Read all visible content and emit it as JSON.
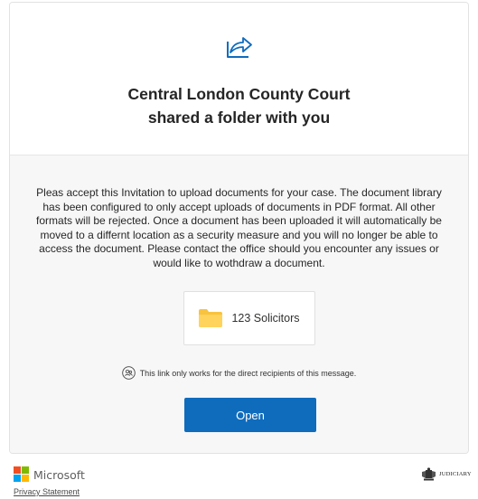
{
  "header": {
    "icon": "share-arrow-icon",
    "title_line1": "Central London County Court",
    "title_line2": "shared a folder with you"
  },
  "message": {
    "text": "Pleas accept this Invitation to upload documents for your case.  The document library has been configured to only accept uploads of documents in PDF format.  All other formats will be rejected.  Once a document has been uploaded it will automatically be moved to a differnt location as a security measure and you will no longer be able to access the document.  Please contact the office should you encounter any issues or would like to wothdraw a document."
  },
  "folder": {
    "icon": "folder-icon",
    "name": "123 Solicitors"
  },
  "notice": {
    "icon": "people-icon",
    "text": "This link only works for the direct recipients of this message."
  },
  "actions": {
    "open_label": "Open"
  },
  "footer": {
    "brand": "Microsoft",
    "privacy_label": "Privacy Statement",
    "partner_logo_text": "JUDICIARY"
  },
  "colors": {
    "accent": "#0f6cbd",
    "folder": "#f8c33e",
    "body_bg": "#f7f7f7"
  }
}
